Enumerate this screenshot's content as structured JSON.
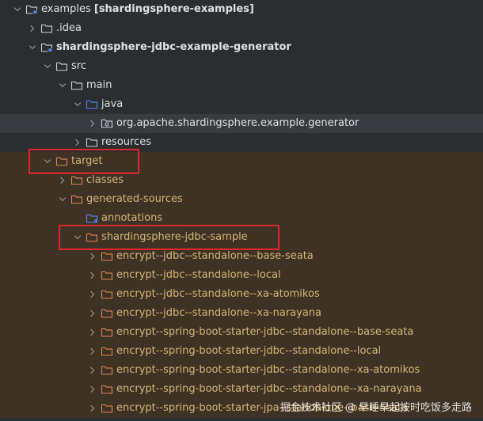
{
  "tree": {
    "rows": [
      {
        "label": "examples",
        "suffix": "[shardingsphere-examples]",
        "icon": "module-folder-icon",
        "state": "expanded",
        "level": 0
      },
      {
        "label": ".idea",
        "suffix": "",
        "icon": "folder-icon",
        "state": "collapsed",
        "level": 1
      },
      {
        "label": "shardingsphere-jdbc-example-generator",
        "suffix": "",
        "icon": "module-folder-icon",
        "state": "expanded",
        "level": 1,
        "bold": true
      },
      {
        "label": "src",
        "suffix": "",
        "icon": "folder-icon",
        "state": "expanded",
        "level": 2
      },
      {
        "label": "main",
        "suffix": "",
        "icon": "folder-icon",
        "state": "expanded",
        "level": 3
      },
      {
        "label": "java",
        "suffix": "",
        "icon": "source-root-folder-icon",
        "state": "expanded",
        "level": 4
      },
      {
        "label": "org.apache.shardingsphere.example.generator",
        "suffix": "",
        "icon": "package-icon",
        "state": "collapsed",
        "level": 5,
        "selected": true
      },
      {
        "label": "resources",
        "suffix": "",
        "icon": "folder-icon",
        "state": "collapsed",
        "level": 4
      },
      {
        "label": "target",
        "suffix": "",
        "icon": "excluded-folder-icon",
        "state": "expanded",
        "level": 2,
        "excluded": true,
        "highlight": true
      },
      {
        "label": "classes",
        "suffix": "",
        "icon": "excluded-folder-icon",
        "state": "collapsed",
        "level": 3,
        "excluded": true
      },
      {
        "label": "generated-sources",
        "suffix": "",
        "icon": "excluded-folder-icon",
        "state": "expanded",
        "level": 3,
        "excluded": true
      },
      {
        "label": "annotations",
        "suffix": "",
        "icon": "generated-sources-folder-icon",
        "state": "none",
        "level": 4,
        "excluded": true
      },
      {
        "label": "shardingsphere-jdbc-sample",
        "suffix": "",
        "icon": "excluded-folder-icon",
        "state": "expanded",
        "level": 4,
        "excluded": true,
        "highlight": true
      },
      {
        "label": "encrypt--jdbc--standalone--base-seata",
        "suffix": "",
        "icon": "excluded-folder-icon",
        "state": "collapsed",
        "level": 5,
        "excluded": true
      },
      {
        "label": "encrypt--jdbc--standalone--local",
        "suffix": "",
        "icon": "excluded-folder-icon",
        "state": "collapsed",
        "level": 5,
        "excluded": true
      },
      {
        "label": "encrypt--jdbc--standalone--xa-atomikos",
        "suffix": "",
        "icon": "excluded-folder-icon",
        "state": "collapsed",
        "level": 5,
        "excluded": true
      },
      {
        "label": "encrypt--jdbc--standalone--xa-narayana",
        "suffix": "",
        "icon": "excluded-folder-icon",
        "state": "collapsed",
        "level": 5,
        "excluded": true
      },
      {
        "label": "encrypt--spring-boot-starter-jdbc--standalone--base-seata",
        "suffix": "",
        "icon": "excluded-folder-icon",
        "state": "collapsed",
        "level": 5,
        "excluded": true
      },
      {
        "label": "encrypt--spring-boot-starter-jdbc--standalone--local",
        "suffix": "",
        "icon": "excluded-folder-icon",
        "state": "collapsed",
        "level": 5,
        "excluded": true
      },
      {
        "label": "encrypt--spring-boot-starter-jdbc--standalone--xa-atomikos",
        "suffix": "",
        "icon": "excluded-folder-icon",
        "state": "collapsed",
        "level": 5,
        "excluded": true
      },
      {
        "label": "encrypt--spring-boot-starter-jdbc--standalone--xa-narayana",
        "suffix": "",
        "icon": "excluded-folder-icon",
        "state": "collapsed",
        "level": 5,
        "excluded": true
      },
      {
        "label": "encrypt--spring-boot-starter-jpa--standalone--base-seata",
        "suffix": "",
        "icon": "excluded-folder-icon",
        "state": "collapsed",
        "level": 5,
        "excluded": true
      }
    ]
  },
  "watermark": "掘金技术社区 @ 早睡早起按时吃饭多走路",
  "colors": {
    "background": "#2b2d30",
    "excluded_background": "#3d3223",
    "selected_background": "#393b40",
    "excluded_text": "#d5b778",
    "folder_outline": "#ced0d6",
    "excluded_folder": "#e08855",
    "source_root_folder": "#548af7",
    "highlight_box": "#e0262b"
  }
}
